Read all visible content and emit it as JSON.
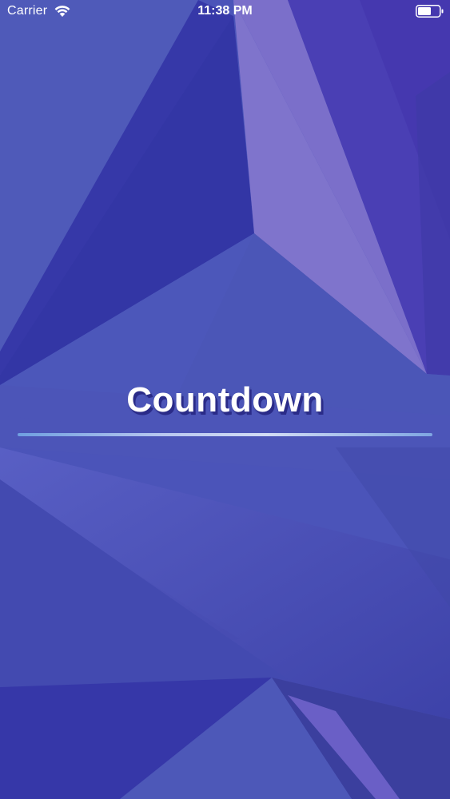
{
  "status_bar": {
    "carrier": "Carrier",
    "time": "11:38 PM",
    "wifi_icon": "wifi-icon",
    "battery_icon": "battery-icon"
  },
  "main": {
    "title": "Countdown"
  },
  "colors": {
    "background": "#4a52b8",
    "title_text": "#ffffff",
    "title_shadow": "#2a2b88",
    "divider": "#a9c0ee"
  }
}
